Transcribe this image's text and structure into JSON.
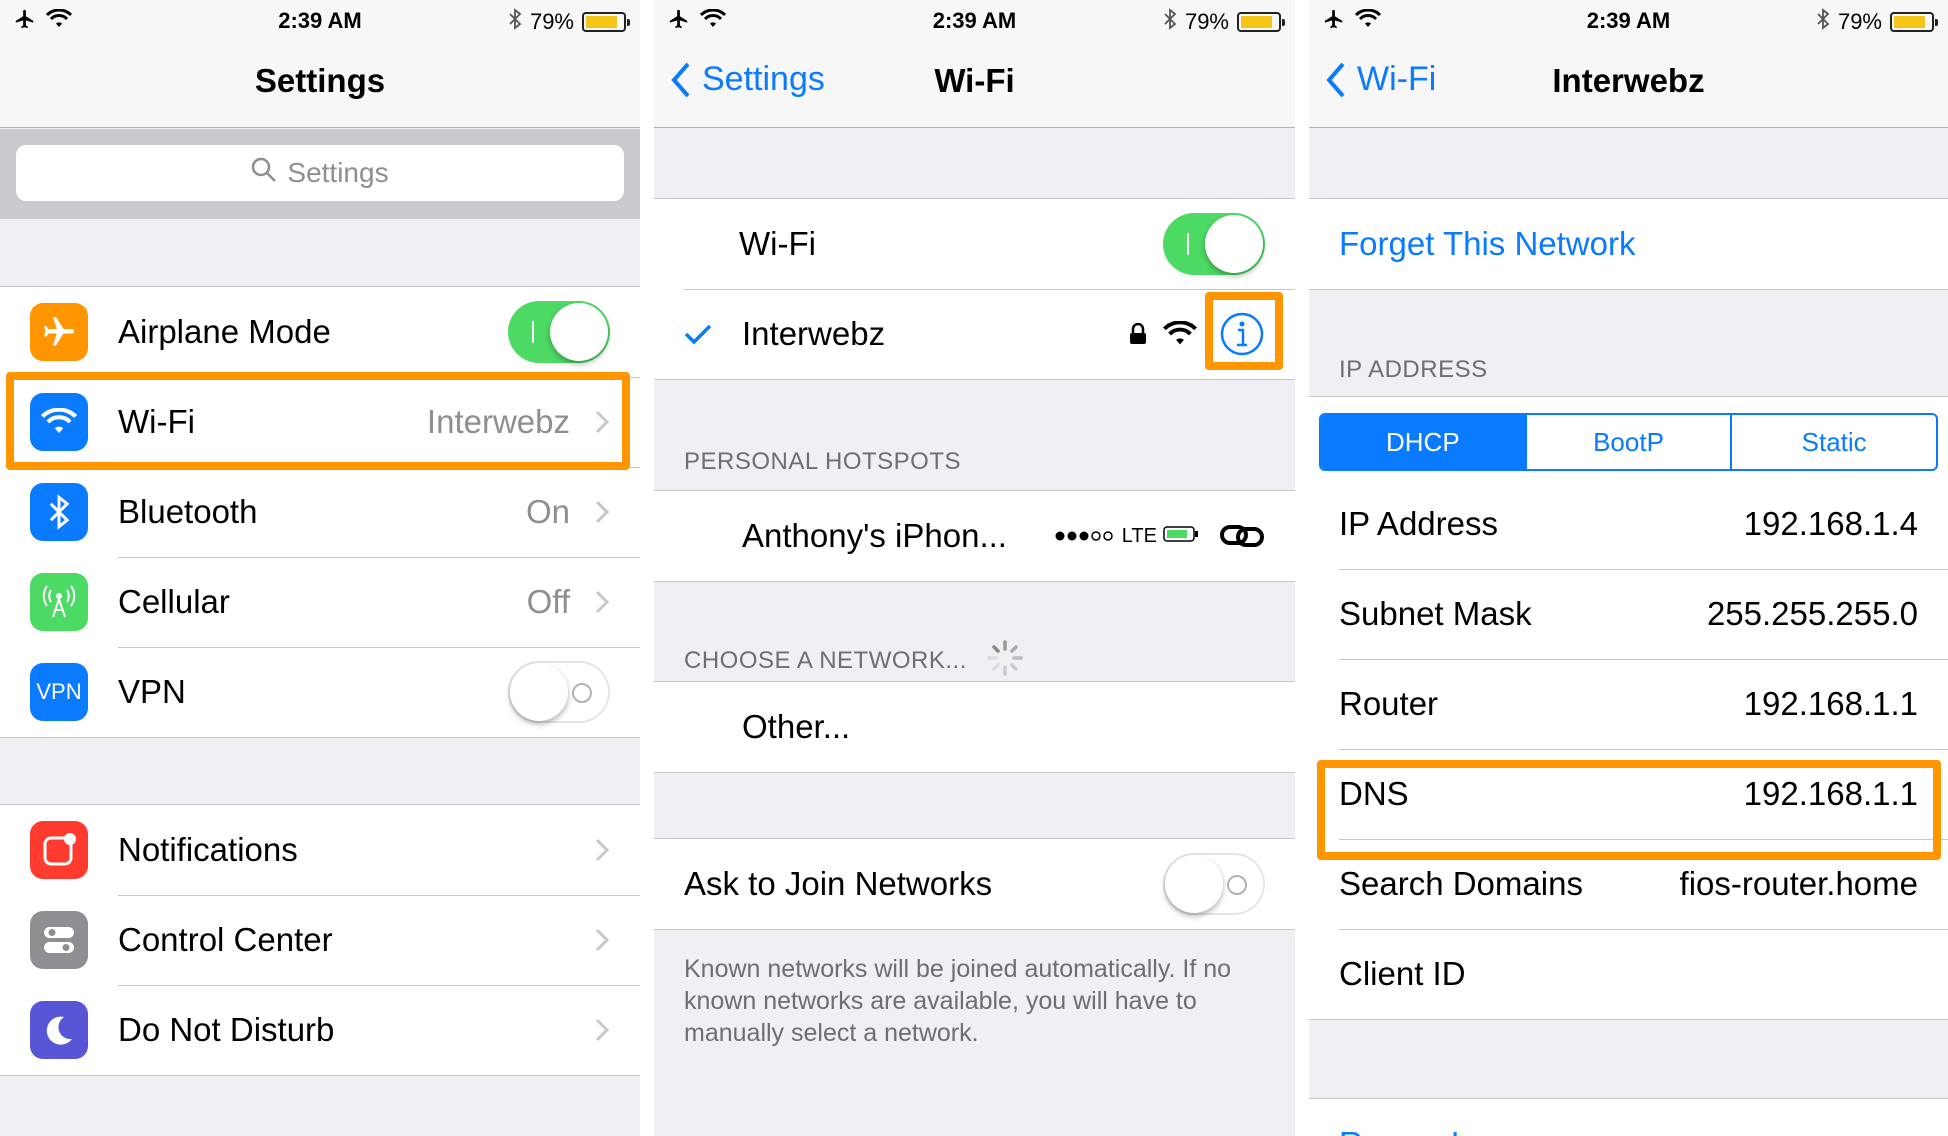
{
  "status": {
    "time": "2:39 AM",
    "battery": "79%"
  },
  "settings_screen": {
    "title": "Settings",
    "search_placeholder": "Settings",
    "items": [
      {
        "label": "Airplane Mode",
        "value": ""
      },
      {
        "label": "Wi-Fi",
        "value": "Interwebz"
      },
      {
        "label": "Bluetooth",
        "value": "On"
      },
      {
        "label": "Cellular",
        "value": "Off"
      },
      {
        "label": "VPN",
        "value": ""
      }
    ],
    "items2": [
      {
        "label": "Notifications"
      },
      {
        "label": "Control Center"
      },
      {
        "label": "Do Not Disturb"
      }
    ]
  },
  "wifi_screen": {
    "back": "Settings",
    "title": "Wi-Fi",
    "wifi_label": "Wi-Fi",
    "network": "Interwebz",
    "hotspots_header": "PERSONAL HOTSPOTS",
    "hotspot_name": "Anthony's iPhon...",
    "hotspot_signal": "LTE",
    "choose_header": "CHOOSE A NETWORK...",
    "other": "Other...",
    "ask_join": "Ask to Join Networks",
    "footer": "Known networks will be joined automatically. If no known networks are available, you will have to manually select a network."
  },
  "network_screen": {
    "back": "Wi-Fi",
    "title": "Interwebz",
    "forget": "Forget This Network",
    "ip_header": "IP ADDRESS",
    "segments": [
      "DHCP",
      "BootP",
      "Static"
    ],
    "rows": [
      {
        "label": "IP Address",
        "value": "192.168.1.4"
      },
      {
        "label": "Subnet Mask",
        "value": "255.255.255.0"
      },
      {
        "label": "Router",
        "value": "192.168.1.1"
      },
      {
        "label": "DNS",
        "value": "192.168.1.1"
      },
      {
        "label": "Search Domains",
        "value": "fios-router.home"
      },
      {
        "label": "Client ID",
        "value": ""
      }
    ],
    "renew": "Renew Lease"
  }
}
